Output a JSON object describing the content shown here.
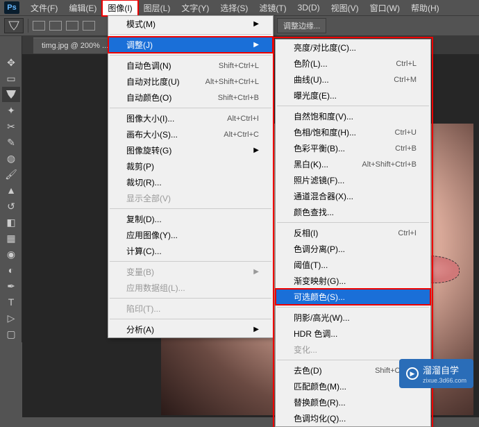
{
  "menubar": {
    "items": [
      "文件(F)",
      "编辑(E)",
      "图像(I)",
      "图层(L)",
      "文字(Y)",
      "选择(S)",
      "滤镜(T)",
      "3D(D)",
      "视图(V)",
      "窗口(W)",
      "帮助(H)"
    ],
    "active_index": 2
  },
  "optionsbar": {
    "refine_edge": "调整边缘..."
  },
  "doc": {
    "tab": "timg.jpg @ 200% ..."
  },
  "menu1": {
    "mode": "模式(M)",
    "adjust": "调整(J)",
    "auto_tone": "自动色调(N)",
    "auto_tone_sc": "Shift+Ctrl+L",
    "auto_contrast": "自动对比度(U)",
    "auto_contrast_sc": "Alt+Shift+Ctrl+L",
    "auto_color": "自动颜色(O)",
    "auto_color_sc": "Shift+Ctrl+B",
    "image_size": "图像大小(I)...",
    "image_size_sc": "Alt+Ctrl+I",
    "canvas_size": "画布大小(S)...",
    "canvas_size_sc": "Alt+Ctrl+C",
    "rotate": "图像旋转(G)",
    "crop": "裁剪(P)",
    "trim": "裁切(R)...",
    "reveal_all": "显示全部(V)",
    "duplicate": "复制(D)...",
    "apply_image": "应用图像(Y)...",
    "calculations": "计算(C)...",
    "variables": "变量(B)",
    "apply_data": "应用数据组(L)...",
    "trap": "陷印(T)...",
    "analysis": "分析(A)"
  },
  "menu2": {
    "brightness": "亮度/对比度(C)...",
    "levels": "色阶(L)...",
    "levels_sc": "Ctrl+L",
    "curves": "曲线(U)...",
    "curves_sc": "Ctrl+M",
    "exposure": "曝光度(E)...",
    "vibrance": "自然饱和度(V)...",
    "hue": "色相/饱和度(H)...",
    "hue_sc": "Ctrl+U",
    "balance": "色彩平衡(B)...",
    "balance_sc": "Ctrl+B",
    "bw": "黑白(K)...",
    "bw_sc": "Alt+Shift+Ctrl+B",
    "photo_filter": "照片滤镜(F)...",
    "channel_mixer": "通道混合器(X)...",
    "color_lookup": "颜色查找...",
    "invert": "反相(I)",
    "invert_sc": "Ctrl+I",
    "posterize": "色调分离(P)...",
    "threshold": "阈值(T)...",
    "gradient_map": "渐变映射(G)...",
    "selective": "可选颜色(S)...",
    "shadows": "阴影/高光(W)...",
    "hdr": "HDR 色调...",
    "variations": "变化...",
    "desaturate": "去色(D)",
    "desaturate_sc": "Shift+Ctrl+U",
    "match": "匹配颜色(M)...",
    "replace": "替换颜色(R)...",
    "equalize": "色调均化(Q)..."
  },
  "watermark": {
    "brand": "溜溜自学",
    "sub": "zixue.3d66.com"
  }
}
